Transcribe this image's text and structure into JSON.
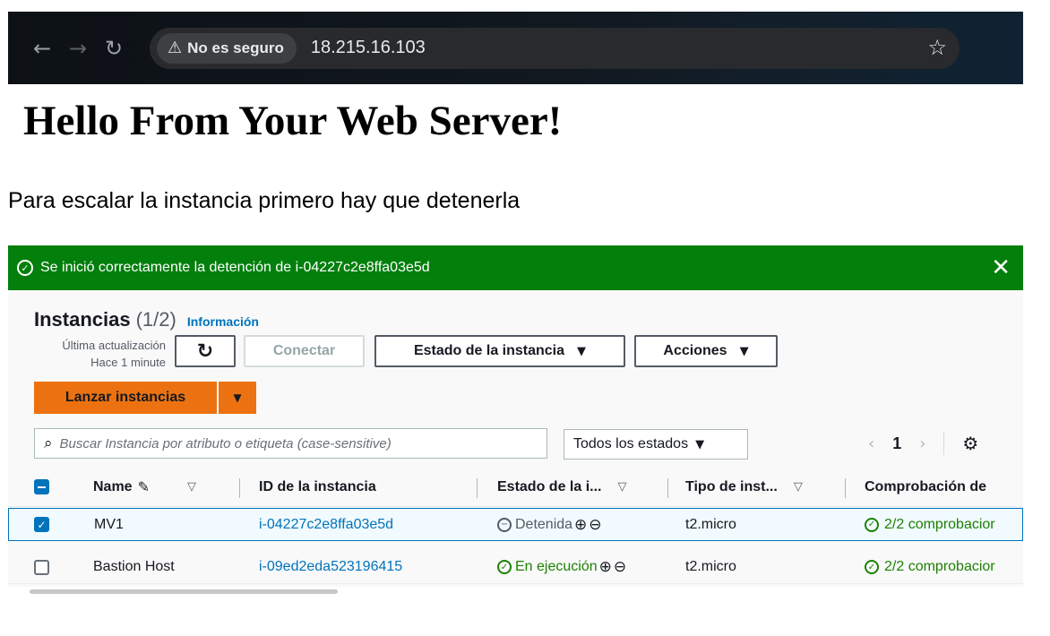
{
  "browser": {
    "security_label": "No es seguro",
    "url": "18.215.16.103"
  },
  "page": {
    "heading": "Hello From Your Web Server!",
    "caption": "Para escalar la instancia primero hay que detenerla"
  },
  "flash": {
    "message": "Se inició correctamente la detención de i-04227c2e8ffa03e5d"
  },
  "instances": {
    "title": "Instancias",
    "count": "(1/2)",
    "info_link": "Información",
    "last_update_label": "Última actualización",
    "last_update_value": "Hace 1 minute",
    "connect_label": "Conectar",
    "state_menu_label": "Estado de la instancia",
    "actions_label": "Acciones",
    "launch_label": "Lanzar instancias",
    "search_placeholder": "Buscar Instancia por atributo o etiqueta (case-sensitive)",
    "filter_value": "Todos los estados",
    "page_number": "1",
    "columns": {
      "name": "Name",
      "id": "ID de la instancia",
      "state": "Estado de la i...",
      "type": "Tipo de inst...",
      "checks": "Comprobación de"
    },
    "rows": [
      {
        "name": "MV1",
        "id": "i-04227c2e8ffa03e5d",
        "state": "Detenida",
        "type": "t2.micro",
        "checks": "2/2 comprobacior",
        "selected": true
      },
      {
        "name": "Bastion Host",
        "id": "i-09ed2eda523196415",
        "state": "En ejecución",
        "type": "t2.micro",
        "checks": "2/2 comprobacior",
        "selected": false
      }
    ]
  },
  "colors": {
    "flash_success": "#037f0c",
    "primary_orange": "#ec7211",
    "link_blue": "#0073bb",
    "running_green": "#1d8102"
  }
}
